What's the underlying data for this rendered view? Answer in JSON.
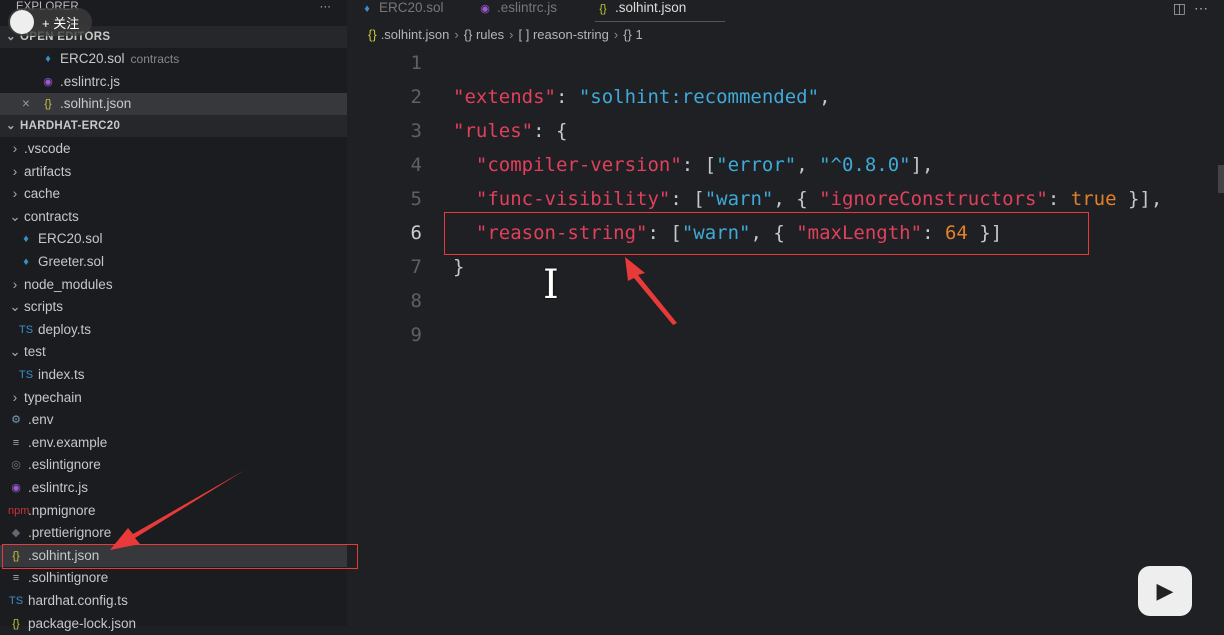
{
  "overlay": {
    "follow_label": "+ 关注"
  },
  "sidebar": {
    "title": "EXPLORER",
    "more": "···",
    "open_editors_label": "OPEN EDITORS",
    "open_editors": [
      {
        "name": "ERC20.sol",
        "desc": "contracts",
        "icon": "ethereum-icon"
      },
      {
        "name": ".eslintrc.js",
        "icon": "eslint-icon"
      },
      {
        "name": ".solhint.json",
        "icon": "json-icon",
        "close": "×"
      }
    ],
    "project_label": "HARDHAT-ERC20",
    "tree": [
      {
        "name": ".vscode",
        "type": "folder",
        "open": false,
        "depth": 0
      },
      {
        "name": "artifacts",
        "type": "folder",
        "open": false,
        "depth": 0
      },
      {
        "name": "cache",
        "type": "folder",
        "open": false,
        "depth": 0
      },
      {
        "name": "contracts",
        "type": "folder",
        "open": true,
        "depth": 0
      },
      {
        "name": "ERC20.sol",
        "icon": "ethereum-icon",
        "depth": 1
      },
      {
        "name": "Greeter.sol",
        "icon": "ethereum-icon",
        "depth": 1
      },
      {
        "name": "node_modules",
        "type": "folder",
        "open": false,
        "depth": 0
      },
      {
        "name": "scripts",
        "type": "folder",
        "open": true,
        "depth": 0
      },
      {
        "name": "deploy.ts",
        "icon": "typescript-icon",
        "depth": 1
      },
      {
        "name": "test",
        "type": "folder",
        "open": true,
        "depth": 0
      },
      {
        "name": "index.ts",
        "icon": "typescript-icon",
        "depth": 1
      },
      {
        "name": "typechain",
        "type": "folder",
        "open": false,
        "depth": 0
      },
      {
        "name": ".env",
        "icon": "gear-icon",
        "depth": 0
      },
      {
        "name": ".env.example",
        "icon": "lines-icon",
        "depth": 0
      },
      {
        "name": ".eslintignore",
        "icon": "eslint-gray-icon",
        "depth": 0
      },
      {
        "name": ".eslintrc.js",
        "icon": "eslint-icon",
        "depth": 0
      },
      {
        "name": ".npmignore",
        "icon": "npm-icon",
        "depth": 0
      },
      {
        "name": ".prettierignore",
        "icon": "prettier-icon",
        "depth": 0
      },
      {
        "name": ".solhint.json",
        "icon": "json-icon",
        "depth": 0,
        "selected": true
      },
      {
        "name": ".solhintignore",
        "icon": "lines-icon",
        "depth": 0
      },
      {
        "name": "hardhat.config.ts",
        "icon": "typescript-icon",
        "depth": 0
      },
      {
        "name": "package-lock.json",
        "icon": "json-icon",
        "depth": 0
      }
    ]
  },
  "tabs": [
    {
      "label": "ERC20.sol",
      "icon": "ethereum-icon"
    },
    {
      "label": ".eslintrc.js",
      "icon": "eslint-icon"
    },
    {
      "label": ".solhint.json",
      "icon": "json-icon",
      "active": true
    }
  ],
  "breadcrumb": [
    ".solhint.json",
    "{} rules",
    "[ ] reason-string",
    "{} 1"
  ],
  "editor": {
    "current_line": 6,
    "lines": [
      [],
      [
        [
          "k",
          "\"extends\""
        ],
        [
          "p",
          ": "
        ],
        [
          "s",
          "\"solhint:recommended\""
        ],
        [
          "p",
          ","
        ]
      ],
      [
        [
          "k",
          "\"rules\""
        ],
        [
          "p",
          ": {"
        ]
      ],
      [
        [
          "p",
          "  "
        ],
        [
          "k",
          "\"compiler-version\""
        ],
        [
          "p",
          ": ["
        ],
        [
          "s",
          "\"error\""
        ],
        [
          "p",
          ", "
        ],
        [
          "s",
          "\"^0.8.0\""
        ],
        [
          "p",
          "],"
        ]
      ],
      [
        [
          "p",
          "  "
        ],
        [
          "k",
          "\"func-visibility\""
        ],
        [
          "p",
          ": ["
        ],
        [
          "s",
          "\"warn\""
        ],
        [
          "p",
          ", { "
        ],
        [
          "k",
          "\"ignoreConstructors\""
        ],
        [
          "p",
          ": "
        ],
        [
          "n",
          "true"
        ],
        [
          "p",
          " }],"
        ]
      ],
      [
        [
          "p",
          "  "
        ],
        [
          "k",
          "\"reason-string\""
        ],
        [
          "p",
          ": ["
        ],
        [
          "s",
          "\"warn\""
        ],
        [
          "p",
          ", { "
        ],
        [
          "k",
          "\"maxLength\""
        ],
        [
          "p",
          ": "
        ],
        [
          "n",
          "64"
        ],
        [
          "p",
          " }]"
        ]
      ],
      [
        [
          "p",
          "}"
        ]
      ],
      [],
      []
    ]
  },
  "colors": {
    "key": "#e0405c",
    "string": "#3fa9d8",
    "number": "#e5802a",
    "annotation": "#e83a3a"
  }
}
